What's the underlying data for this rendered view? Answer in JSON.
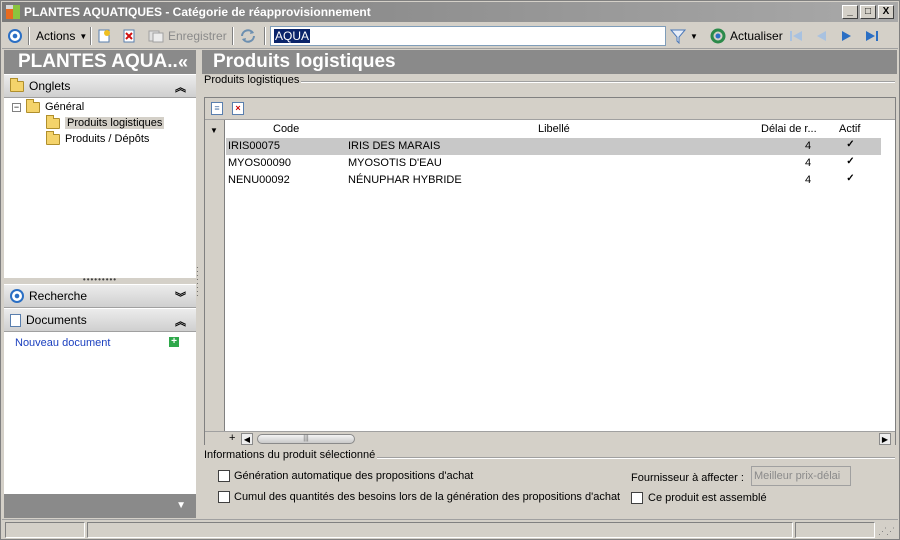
{
  "window": {
    "title": "PLANTES AQUATIQUES -  Catégorie de réapprovisionnement",
    "minimize": "_",
    "maximize": "□",
    "close": "X"
  },
  "toolbar": {
    "actions_label": "Actions",
    "save_label": "Enregistrer",
    "search_value": "AQUA",
    "refresh_label": "Actualiser"
  },
  "left_panel": {
    "header_title": "PLANTES AQUA..",
    "collapse_glyph": "«",
    "tabs_section": "Onglets",
    "tree": {
      "root": "Général",
      "children": [
        "Produits logistiques",
        "Produits / Dépôts"
      ]
    },
    "search_section": "Recherche",
    "documents_section": "Documents",
    "new_document": "Nouveau document"
  },
  "main": {
    "header_title": "Produits logistiques",
    "group_title": "Produits logistiques",
    "grid": {
      "columns": [
        "Code",
        "Libellé",
        "Délai de r...",
        "Actif"
      ],
      "rows": [
        {
          "code": "IRIS00075",
          "label": "IRIS DES MARAIS",
          "delay": "4",
          "active": true
        },
        {
          "code": "MYOS00090",
          "label": "MYOSOTIS D'EAU",
          "delay": "4",
          "active": true
        },
        {
          "code": "NENU00092",
          "label": "NÉNUPHAR HYBRIDE",
          "delay": "4",
          "active": true
        }
      ],
      "selected_row": 0
    },
    "info": {
      "group_title": "Informations du produit sélectionné",
      "opt_auto_gen": "Génération automatique des propositions d'achat",
      "opt_cumul": "Cumul des quantités des besoins lors de la génération des propositions d'achat",
      "supplier_label": "Fournisseur à affecter :",
      "supplier_value": "Meilleur prix-délai",
      "opt_assembled": "Ce produit est assemblé"
    }
  },
  "colors": {
    "panel_header": "#8a8a8a",
    "selected_row": "#c8c8c8",
    "link": "#1a3fbf",
    "accent_blue": "#2b6fc4"
  }
}
